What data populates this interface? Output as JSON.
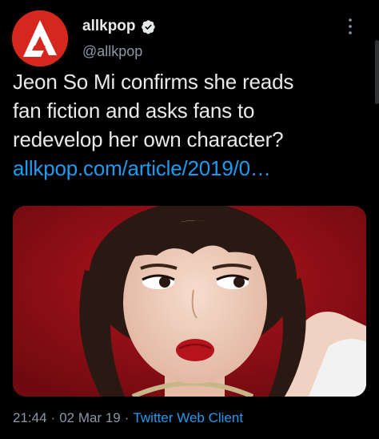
{
  "colors": {
    "background": "#000000",
    "text": "#e7e9ea",
    "secondary_text": "#8b98a5",
    "link": "#1d9bf0",
    "avatar_brand": "#d6271f"
  },
  "author": {
    "display_name": "allkpop",
    "handle": "@allkpop",
    "avatar_icon": "allkpop-logo-icon",
    "verified_icon": "verified-badge-icon"
  },
  "tweet": {
    "text_lines": [
      "Jeon So Mi confirms she reads",
      "fan fiction and asks fans to",
      "redevelop her own character?"
    ],
    "link_text": "allkpop.com/article/2019/0…",
    "media_description_icon": "photo-woman-red-background"
  },
  "meta": {
    "time": "21:44",
    "date": "02 Mar 19",
    "separator": "·",
    "client": "Twitter Web Client"
  },
  "menu": {
    "icon": "more-vertical-icon"
  }
}
